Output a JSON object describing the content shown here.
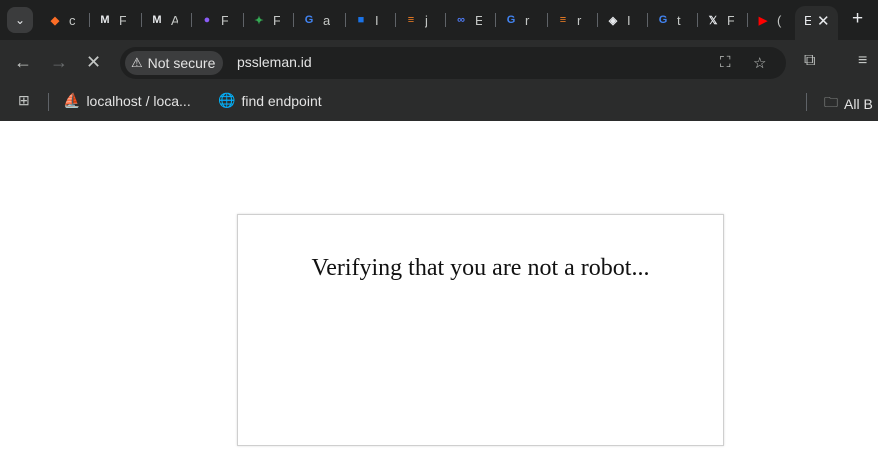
{
  "tabs": [
    {
      "icon": "gitlab-icon",
      "glyph": "◆",
      "color": "#fc6d26",
      "label": "c"
    },
    {
      "icon": "m-logo-icon",
      "glyph": "M",
      "color": "#e8eaed",
      "label": "F"
    },
    {
      "icon": "m-logo-icon",
      "glyph": "M",
      "color": "#e8eaed",
      "label": "A"
    },
    {
      "icon": "firefox-icon",
      "glyph": "●",
      "color": "#8a5cf6",
      "label": "F"
    },
    {
      "icon": "green-leaf-icon",
      "glyph": "✦",
      "color": "#34a853",
      "label": "F"
    },
    {
      "icon": "google-icon",
      "glyph": "G",
      "color": "#4285f4",
      "label": "a"
    },
    {
      "icon": "blue-square-icon",
      "glyph": "■",
      "color": "#1a73e8",
      "label": "I"
    },
    {
      "icon": "stackoverflow-icon",
      "glyph": "≡",
      "color": "#f48024",
      "label": "j"
    },
    {
      "icon": "meta-icon",
      "glyph": "∞",
      "color": "#4e7bf6",
      "label": "E"
    },
    {
      "icon": "google-icon",
      "glyph": "G",
      "color": "#4285f4",
      "label": "r"
    },
    {
      "icon": "stackoverflow-icon",
      "glyph": "≡",
      "color": "#f48024",
      "label": "r"
    },
    {
      "icon": "layers-icon",
      "glyph": "◈",
      "color": "#e8eaed",
      "label": "I"
    },
    {
      "icon": "google-icon",
      "glyph": "G",
      "color": "#4285f4",
      "label": "t"
    },
    {
      "icon": "x-logo-icon",
      "glyph": "𝕏",
      "color": "#e8eaed",
      "label": "F"
    },
    {
      "icon": "youtube-icon",
      "glyph": "▶",
      "color": "#ff0000",
      "label": "("
    }
  ],
  "active_tab": {
    "label": "E"
  },
  "address_bar": {
    "security_label": "Not secure",
    "url": "pssleman.id"
  },
  "bookmarks": [
    {
      "icon": "phpmyadmin-icon",
      "label": "localhost / loca..."
    },
    {
      "icon": "globe-icon",
      "label": "find endpoint"
    }
  ],
  "all_bookmarks_label": "All B",
  "page": {
    "message": "Verifying that you are not a robot..."
  }
}
